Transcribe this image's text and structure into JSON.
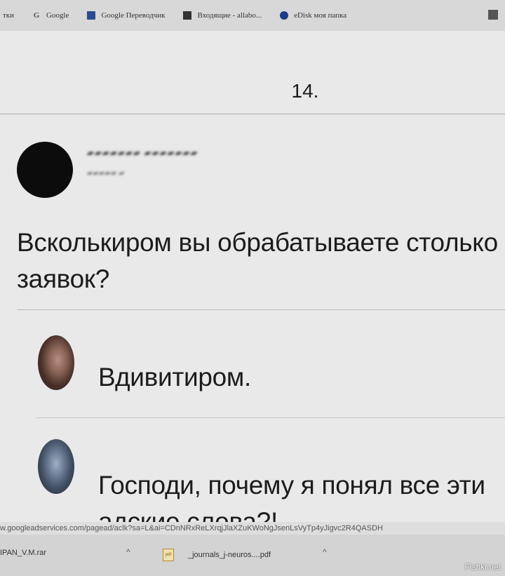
{
  "bookmarks": {
    "items": [
      {
        "label": "тки",
        "icon": "none"
      },
      {
        "label": "Google",
        "icon": "google-icon"
      },
      {
        "label": "Google Переводчик",
        "icon": "translate-icon"
      },
      {
        "label": "Входящие - allabo...",
        "icon": "mail-icon"
      },
      {
        "label": "eDisk моя папка",
        "icon": "disk-icon"
      }
    ]
  },
  "page": {
    "number": "14.",
    "question": "Всколькиром вы обрабатываете столько заявок?",
    "answers": [
      {
        "text": "Вдивитиром."
      },
      {
        "text": "Господи, почему я понял все эти адские слова?!"
      }
    ]
  },
  "status": {
    "url": "w.googleadservices.com/pagead/aclk?sa=L&ai=CDnNRxReLXrqjJlaXZuKWoNgJsenLsVyTp4yJigvc2R4QASDH"
  },
  "downloads": {
    "items": [
      {
        "name": "IPAN_V.M.rar"
      },
      {
        "name": "_journals_j-neuros....pdf"
      }
    ]
  },
  "watermark": "Fishki.net"
}
